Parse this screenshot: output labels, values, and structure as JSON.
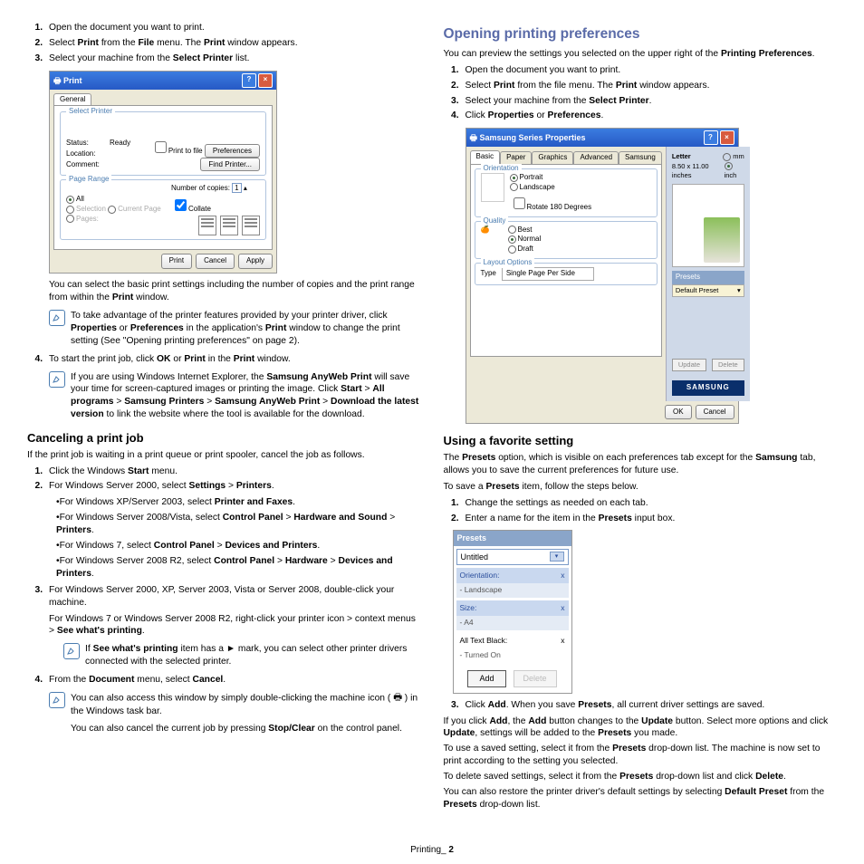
{
  "left": {
    "ol1": {
      "i1": "Open the document you want to print.",
      "i2a": "Select ",
      "i2b": "Print",
      "i2c": " from the ",
      "i2d": "File",
      "i2e": " menu. The ",
      "i2f": "Print",
      "i2g": " window appears.",
      "i3a": "Select your machine from the ",
      "i3b": "Select Printer",
      "i3c": " list."
    },
    "print_dlg": {
      "title": "Print",
      "tab": "General",
      "legend1": "Select Printer",
      "status_k": "Status:",
      "status_v": "Ready",
      "loc_k": "Location:",
      "com_k": "Comment:",
      "chk_file": "Print to file",
      "pref": "Preferences",
      "find": "Find Printer...",
      "legend2": "Page Range",
      "all": "All",
      "sel": "Selection",
      "cur": "Current Page",
      "pages": "Pages:",
      "copies": "Number of copies:",
      "collate": "Collate",
      "b_print": "Print",
      "b_cancel": "Cancel",
      "b_apply": "Apply"
    },
    "p1a": "You can select the basic print settings including the number of copies and the print range from within the ",
    "p1b": "Print",
    "p1c": " window.",
    "note1a": "To take advantage of the printer features provided by your printer driver, click ",
    "note1b": "Properties",
    "note1c": " or ",
    "note1d": "Preferences",
    "note1e": " in the application's ",
    "note1f": "Print",
    "note1g": " window to change the print setting (See \"Opening printing preferences\" on page 2).",
    "ol2_4a": "To start the print job, click ",
    "ol2_4b": "OK",
    "ol2_4c": " or ",
    "ol2_4d": "Print",
    "ol2_4e": " in the ",
    "ol2_4f": "Print",
    "ol2_4g": " window.",
    "note2a": "If you are using Windows Internet Explorer, the ",
    "note2b": "Samsung AnyWeb Print",
    "note2c": " will save your time for screen-captured images or printing the image. Click ",
    "note2d": "Start",
    "note2e": " > ",
    "note2f": "All programs",
    "note2g": " > ",
    "note2h": "Samsung Printers",
    "note2i": " > ",
    "note2j": "Samsung AnyWeb Print",
    "note2k": " > ",
    "note2l": "Download the latest version",
    "note2m": " to link the website where the tool is available for the download.",
    "h_cancel": "Canceling a print job",
    "p_cancel": "If the print job is waiting in a print queue or print spooler, cancel the job as follows.",
    "c1a": "Click the Windows ",
    "c1b": "Start",
    "c1c": " menu.",
    "c2a": "For Windows Server 2000, select ",
    "c2b": "Settings",
    "c2c": " > ",
    "c2d": "Printers",
    "c2e": ".",
    "b1a": "•For Windows XP/Server 2003, select ",
    "b1b": "Printer and Faxes",
    "b1c": ".",
    "b2a": "•For Windows Server 2008/Vista, select ",
    "b2b": "Control Panel",
    "b2c": " > ",
    "b2d": "Hardware and Sound",
    "b2e": " > ",
    "b2f": "Printers",
    "b2g": ".",
    "b3a": "•For Windows 7, select ",
    "b3b": "Control Panel",
    "b3c": " > ",
    "b3d": "Devices and Printers",
    "b3e": ".",
    "b4a": "•For Windows Server 2008 R2, select ",
    "b4b": "Control Panel",
    "b4c": " > ",
    "b4d": "Hardware",
    "b4e": " > ",
    "b4f": "Devices and Printers",
    "b4g": ".",
    "c3": "For Windows Server 2000, XP, Server 2003, Vista or Server 2008, double-click your machine.",
    "c3pa": "For Windows 7 or Windows Server 2008 R2, right-click your printer icon > context menus > ",
    "c3pb": "See what's printing",
    "c3pc": ".",
    "note3a": "If ",
    "note3b": "See what's printing",
    "note3c": " item has a ► mark, you can select other printer drivers connected with the selected printer.",
    "c4a": "From the ",
    "c4b": "Document",
    "c4c": " menu, select ",
    "c4d": "Cancel",
    "c4e": ".",
    "note4a": "You can also access this window by simply double-clicking the machine icon ( ",
    "note4b": " ) in the Windows task bar.",
    "note4c": "You can also cancel the current job by pressing ",
    "note4d": "Stop/Clear",
    "note4e": " on the control panel."
  },
  "right": {
    "h_open": "Opening printing preferences",
    "p1a": "You can preview the settings you selected on the upper right of the ",
    "p1b": "Printing Preferences",
    "p1c": ".",
    "op1": "Open the document you want to print.",
    "op2a": "Select ",
    "op2b": "Print",
    "op2c": " from the file menu. The ",
    "op2d": "Print",
    "op2e": " window appears.",
    "op3a": "Select your machine from the ",
    "op3b": "Select Printer",
    "op3c": ".",
    "op4a": "Click ",
    "op4b": "Properties",
    "op4c": " or ",
    "op4d": "Preferences",
    "op4e": ".",
    "props_dlg": {
      "title": "Samsung Series Properties",
      "tabs": [
        "Basic",
        "Paper",
        "Graphics",
        "Advanced",
        "Samsung"
      ],
      "leg_orient": "Orientation",
      "portrait": "Portrait",
      "landscape": "Landscape",
      "rotate": "Rotate 180 Degrees",
      "leg_quality": "Quality",
      "best": "Best",
      "normal": "Normal",
      "draft": "Draft",
      "leg_layout": "Layout Options",
      "type": "Type",
      "type_val": "Single Page Per Side",
      "paper": "Letter",
      "paper_dim": "8.50 x 11.00 inches",
      "mm": "mm",
      "inch": "inch",
      "presets": "Presets",
      "preset_val": "Default Preset",
      "update": "Update",
      "delete": "Delete",
      "ok": "OK",
      "cancel": "Cancel",
      "logo": "SAMSUNG"
    },
    "h_fav": "Using a favorite setting",
    "pf1a": "The ",
    "pf1b": "Presets",
    "pf1c": " option, which is visible on each preferences tab except for the ",
    "pf1d": "Samsung",
    "pf1e": " tab, allows you to save the current preferences for future use.",
    "pf2a": "To save a ",
    "pf2b": "Presets",
    "pf2c": " item, follow the steps below.",
    "f1": "Change the settings as needed on each tab.",
    "f2a": "Enter a name for the item in the ",
    "f2b": "Presets",
    "f2c": " input box.",
    "presets_dlg": {
      "hdr": "Presets",
      "sel": "Untitled",
      "r1k": "Orientation:",
      "r1v": "- Landscape",
      "r2k": "Size:",
      "r2v": "- A4",
      "r3k": "All Text Black:",
      "r3v": "- Turned On",
      "add": "Add",
      "del": "Delete",
      "x": "x"
    },
    "f3a": "Click ",
    "f3b": "Add",
    "f3c": ". When you save ",
    "f3d": "Presets",
    "f3e": ", all current driver settings are saved.",
    "pf3a": "If you click ",
    "pf3b": "Add",
    "pf3c": ", the ",
    "pf3d": "Add",
    "pf3e": " button changes to the ",
    "pf3f": "Update",
    "pf3g": " button. Select more options and click ",
    "pf3h": "Update",
    "pf3i": ", settings will be added to the ",
    "pf3j": "Presets",
    "pf3k": " you made.",
    "pf4a": "To use a saved setting, select it from the ",
    "pf4b": "Presets",
    "pf4c": " drop-down list. The machine is now set to print according to the setting you selected.",
    "pf5a": "To delete saved settings, select it from the ",
    "pf5b": "Presets",
    "pf5c": " drop-down list and click ",
    "pf5d": "Delete",
    "pf5e": ".",
    "pf6a": "You can also restore the printer driver's default settings by selecting ",
    "pf6b": "Default Preset",
    "pf6c": " from the ",
    "pf6d": "Presets",
    "pf6e": " drop-down list."
  },
  "footer": {
    "label": "Printing",
    "sep": "_ ",
    "page": "2"
  }
}
